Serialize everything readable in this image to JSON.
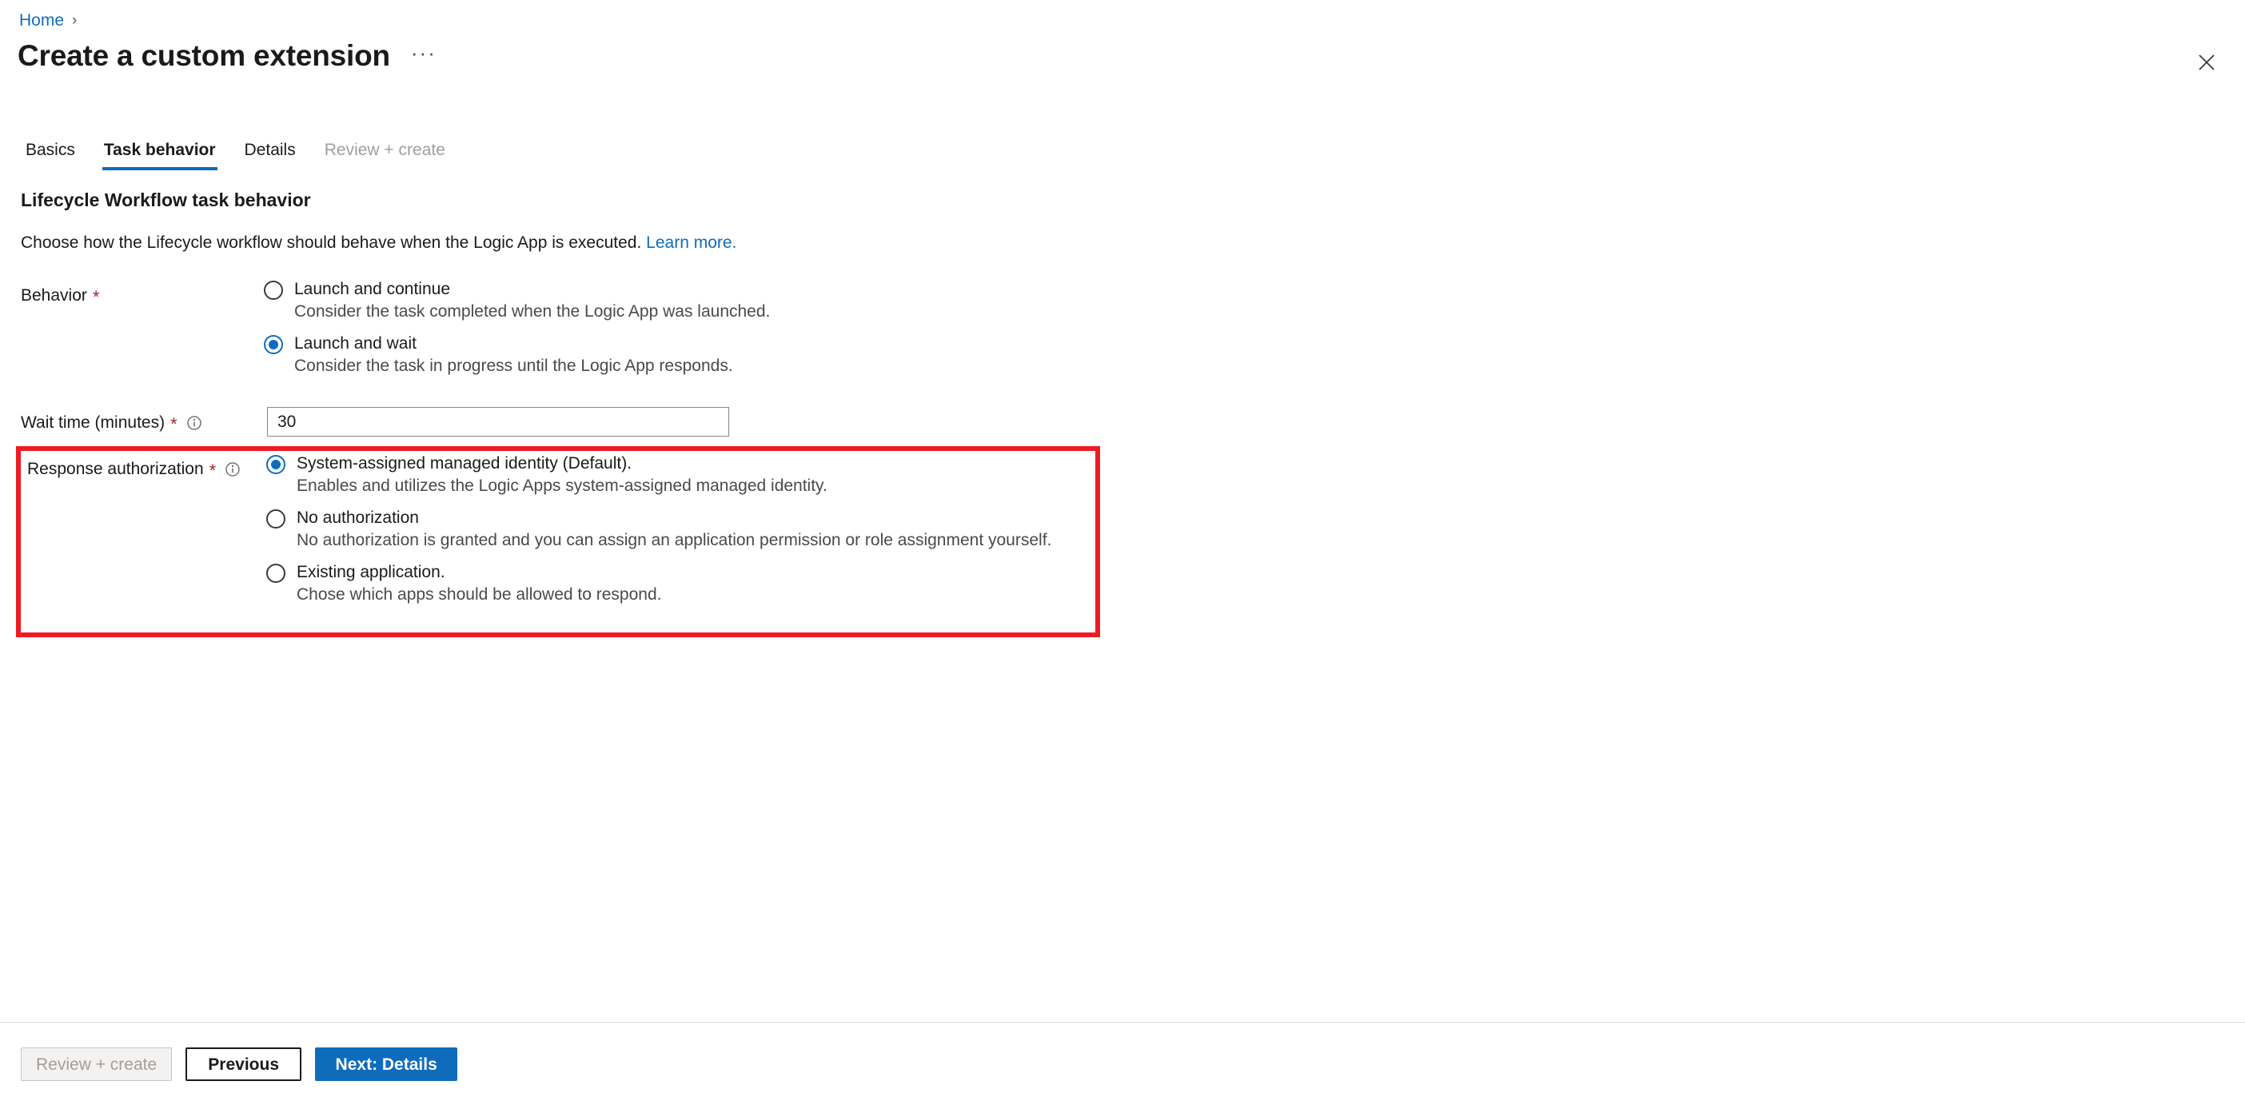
{
  "breadcrumb": {
    "home_label": "Home",
    "separator": "›"
  },
  "header": {
    "title": "Create a custom extension",
    "more_label": "···",
    "close_icon": "close-icon"
  },
  "tabs": [
    {
      "label": "Basics",
      "state": "normal"
    },
    {
      "label": "Task behavior",
      "state": "active"
    },
    {
      "label": "Details",
      "state": "normal"
    },
    {
      "label": "Review + create",
      "state": "disabled"
    }
  ],
  "section": {
    "title": "Lifecycle Workflow task behavior",
    "description": "Choose how the Lifecycle workflow should behave when the Logic App is executed.",
    "learn_more_label": "Learn more."
  },
  "behavior_field": {
    "label": "Behavior",
    "required_marker": "*",
    "options": [
      {
        "label": "Launch and continue",
        "sublabel": "Consider the task completed when the Logic App was launched.",
        "selected": false
      },
      {
        "label": "Launch and wait",
        "sublabel": "Consider the task in progress until the Logic App responds.",
        "selected": true
      }
    ]
  },
  "wait_time_field": {
    "label": "Wait time (minutes)",
    "required_marker": "*",
    "info_icon": "info-icon",
    "value": "30"
  },
  "response_authorization_field": {
    "label": "Response authorization",
    "required_marker": "*",
    "info_icon": "info-icon",
    "options": [
      {
        "label": "System-assigned managed identity (Default).",
        "sublabel": "Enables and utilizes the Logic Apps system-assigned managed identity.",
        "selected": true
      },
      {
        "label": "No authorization",
        "sublabel": "No authorization is granted and you can assign an application permission or role assignment yourself.",
        "selected": false
      },
      {
        "label": "Existing application.",
        "sublabel": "Chose which apps should be allowed to respond.",
        "selected": false
      }
    ]
  },
  "highlight": {
    "color": "#ec1c24"
  },
  "footer": {
    "review_create_label": "Review + create",
    "previous_label": "Previous",
    "next_label": "Next: Details"
  },
  "colors": {
    "accent": "#0f6cbd",
    "link": "#0f6cbd",
    "required": "#a4262c",
    "disabled_text": "#a19f9d",
    "highlight": "#ec1c24"
  }
}
